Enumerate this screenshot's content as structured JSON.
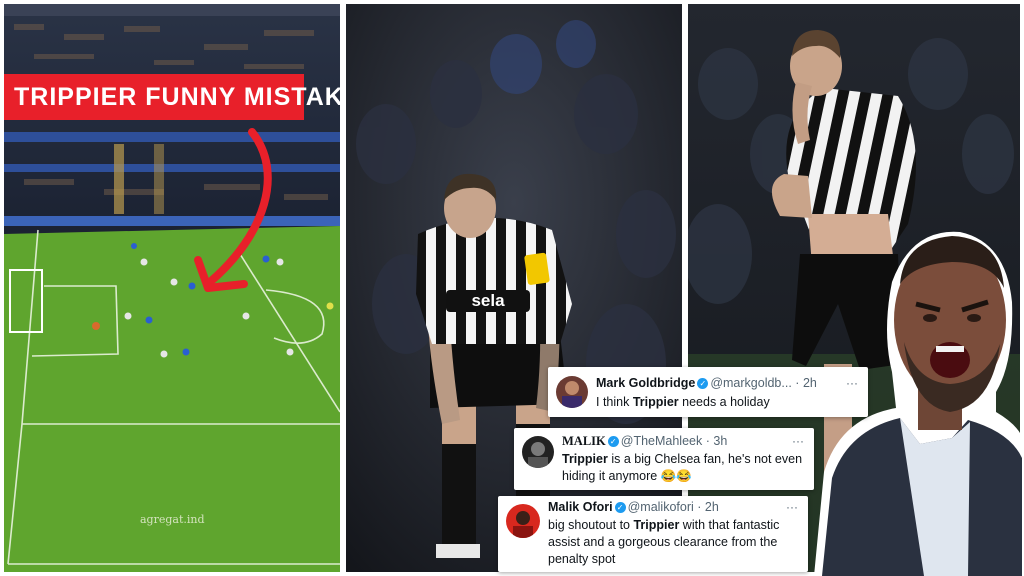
{
  "banner": {
    "text": "TRIPPIER FUNNY MISTAKE"
  },
  "left_panel": {
    "watermark": "agregat.ind"
  },
  "middle_panel": {
    "shirt_sponsor": "sela"
  },
  "tweets": [
    {
      "name": "Mark Goldbridge",
      "handle": "@markgoldb...",
      "sep": "·",
      "time": "2h",
      "more": "···",
      "text_before": "I think ",
      "text_bold": "Trippier",
      "text_after": " needs a holiday"
    },
    {
      "name": "MALIK",
      "handle": "@TheMahleek",
      "sep": "·",
      "time": "3h",
      "more": "···",
      "text_bold": "Trippier",
      "text_after": " is a big Chelsea fan, he's not even",
      "text_line2": "hiding it anymore 😂😂"
    },
    {
      "name": "Malik Ofori",
      "handle": "@malikofori",
      "sep": "·",
      "time": "2h",
      "more": "···",
      "text_before": "big shoutout to ",
      "text_bold": "Trippier",
      "text_after": " with that fantastic",
      "text_line2": "assist and a gorgeous clearance from the",
      "text_line3": "penalty spot"
    }
  ],
  "colors": {
    "banner": "#e8202a",
    "arrow": "#e8202a",
    "pitch": "#5fa52e",
    "verified": "#1d9bf0",
    "reaction_outline": "#ffffff"
  }
}
